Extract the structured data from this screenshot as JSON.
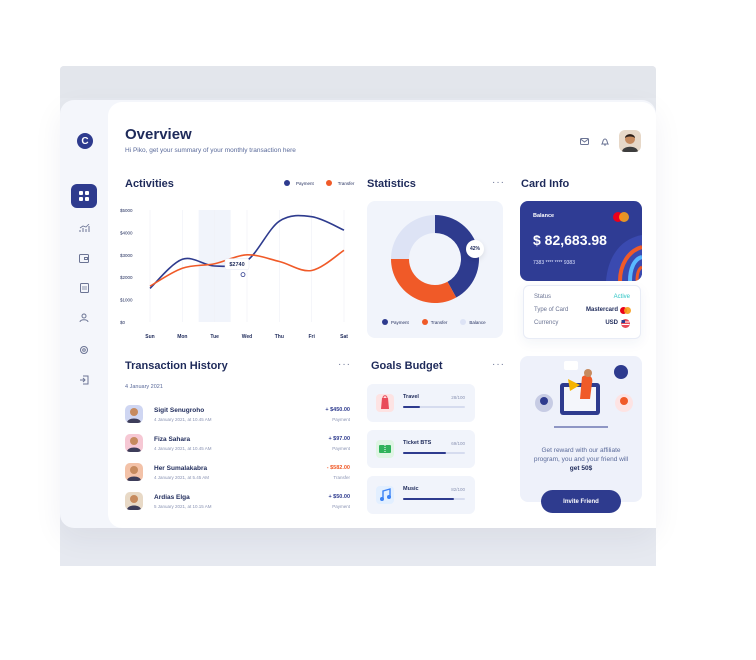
{
  "header": {
    "title": "Overview",
    "subtitle": "Hi Piko, get your summary of your monthly transaction here"
  },
  "sidebar": {
    "logo_letter": "C"
  },
  "activities": {
    "title": "Activities",
    "legend": [
      {
        "label": "Payment",
        "color": "#2e3b8e"
      },
      {
        "label": "Transfer",
        "color": "#f05a28"
      }
    ],
    "tooltip": "$2740"
  },
  "chart_data": {
    "type": "line",
    "title": "Activities",
    "categories": [
      "Sun",
      "Mon",
      "Tue",
      "Wed",
      "Thu",
      "Fri",
      "Sat"
    ],
    "y_ticks": [
      "$5000",
      "$4000",
      "$3000",
      "$2000",
      "$1000",
      "$0"
    ],
    "ylim": [
      0,
      5000
    ],
    "highlight_category": "Tue",
    "series": [
      {
        "name": "Payment",
        "color": "#2e3b8e",
        "values": [
          1500,
          2800,
          2500,
          2740,
          4500,
          4700,
          4100
        ]
      },
      {
        "name": "Transfer",
        "color": "#f05a28",
        "values": [
          1600,
          2400,
          2600,
          3000,
          2700,
          2300,
          3200
        ]
      }
    ],
    "legend_position": "top-right"
  },
  "statistics": {
    "title": "Statistics",
    "percent_label": "42%",
    "slices": [
      {
        "name": "Payment",
        "value": 42,
        "color": "#2e3b8e"
      },
      {
        "name": "Transfer",
        "value": 33,
        "color": "#f05a28"
      },
      {
        "name": "Balance",
        "value": 25,
        "color": "#dde3f5"
      }
    ]
  },
  "card_info": {
    "title": "Card Info",
    "balance_label": "Balance",
    "balance": "$ 82,683.98",
    "card_number": "7383 **** **** 9383",
    "rows": [
      {
        "label": "Status",
        "value": "Active"
      },
      {
        "label": "Type of Card",
        "value": "Mastercard"
      },
      {
        "label": "Currency",
        "value": "USD"
      }
    ]
  },
  "transactions": {
    "title": "Transaction History",
    "date_header": "4 January 2021",
    "items": [
      {
        "name": "Sigit Senugroho",
        "date": "4 January 2021, at 10.45 AM",
        "amount": "+ $450.00",
        "type": "Payment",
        "color": "#2e3b8e",
        "avatar_bg": "#cfd6f2"
      },
      {
        "name": "Fiza Sahara",
        "date": "4 January 2021, at 10.45 AM",
        "amount": "+ $97.00",
        "type": "Payment",
        "color": "#2e3b8e",
        "avatar_bg": "#f6c8d4"
      },
      {
        "name": "Her Sumalakabra",
        "date": "4 January 2021, at 5.45 AM",
        "amount": "- $582.00",
        "type": "Transfer",
        "color": "#f05a28",
        "avatar_bg": "#f3c2a8"
      },
      {
        "name": "Ardias Elga",
        "date": "5 January 2021, at 10.15 AM",
        "amount": "+ $50.00",
        "type": "Payment",
        "color": "#2e3b8e",
        "avatar_bg": "#e8d9c6"
      }
    ]
  },
  "goals": {
    "title": "Goals Budget",
    "items": [
      {
        "title": "Travel",
        "value": "28/100",
        "progress": 0.28,
        "icon_bg": "#fde3e3",
        "icon_color": "#e94b5a",
        "icon": "bag-icon"
      },
      {
        "title": "Ticket BTS",
        "value": "69/100",
        "progress": 0.69,
        "icon_bg": "#dff5e4",
        "icon_color": "#2fb35a",
        "icon": "ticket-icon"
      },
      {
        "title": "Music",
        "value": "82/100",
        "progress": 0.82,
        "icon_bg": "#e2efff",
        "icon_color": "#3b82f6",
        "icon": "music-icon"
      }
    ]
  },
  "promo": {
    "text1": "Get reward with our affiliate program, you and your friend will",
    "text_bold": "get 50$",
    "button": "Invite Friend"
  }
}
